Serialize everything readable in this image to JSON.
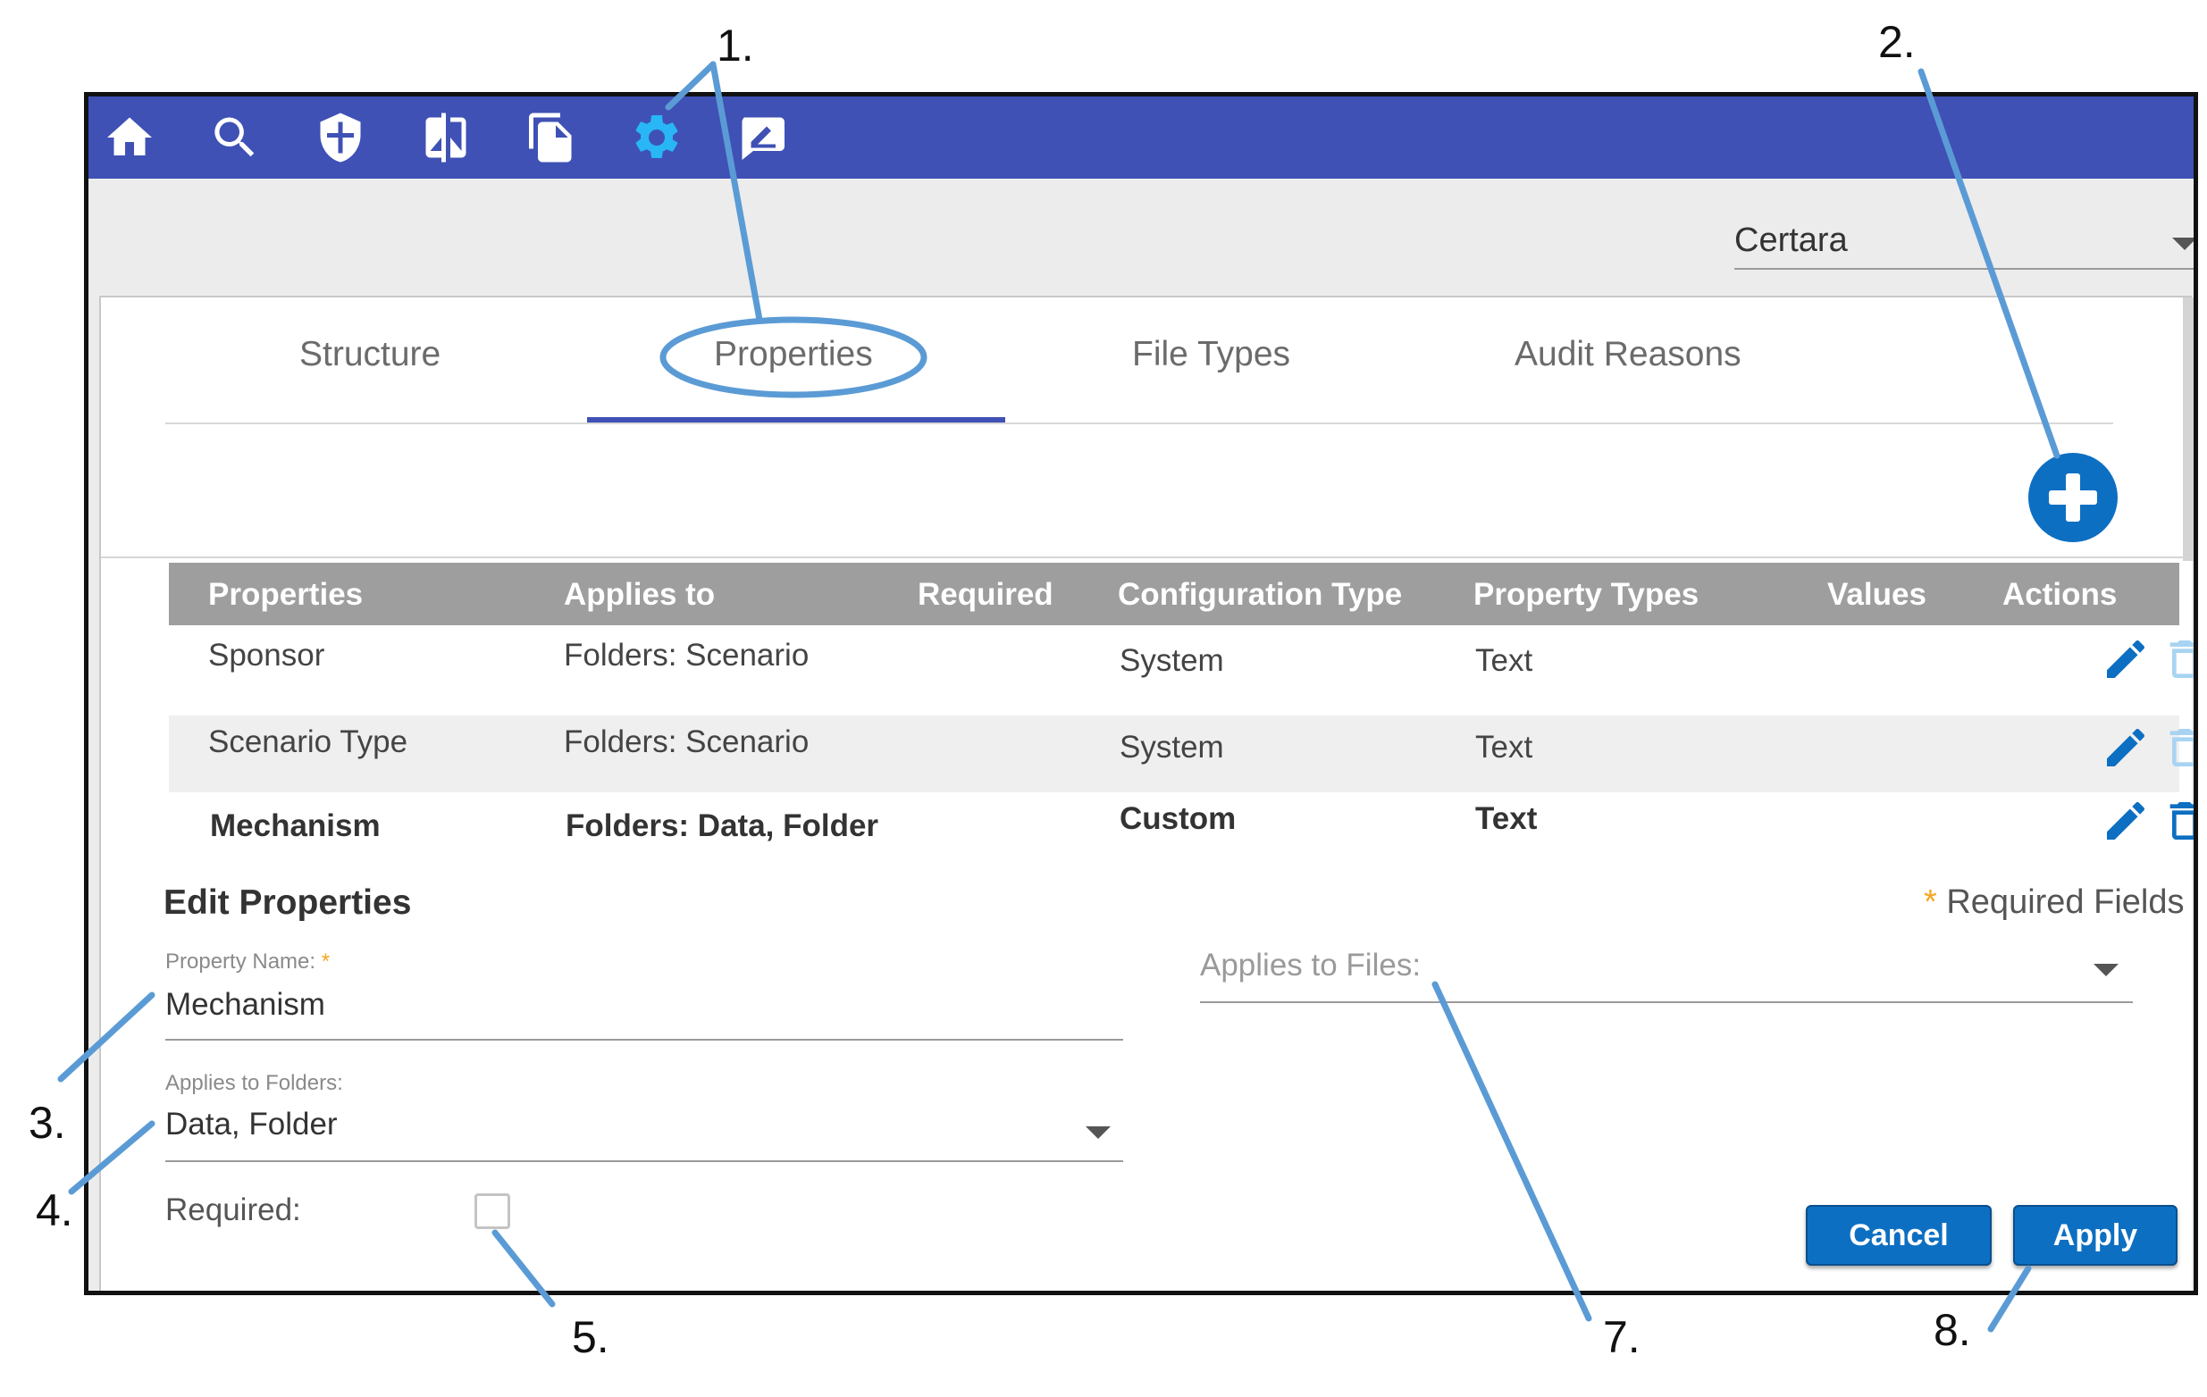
{
  "colors": {
    "topbar": "#3f51b5",
    "accent": "#0d6fc2",
    "active_icon": "#29b6f6",
    "table_header": "#9e9e9e",
    "callout": "#5b9bd5",
    "required_star": "#f5a623"
  },
  "toolbar": {
    "icons": [
      "home-icon",
      "search-icon",
      "shield-icon",
      "compare-icon",
      "documents-icon",
      "gear-icon",
      "signature-icon"
    ],
    "active": "gear-icon"
  },
  "organization": {
    "selected": "Certara"
  },
  "tabs": [
    {
      "label": "Structure"
    },
    {
      "label": "Properties",
      "active": true
    },
    {
      "label": "File Types"
    },
    {
      "label": "Audit Reasons"
    }
  ],
  "table": {
    "headers": [
      "Properties",
      "Applies to",
      "Required",
      "Configuration Type",
      "Property Types",
      "Values",
      "Actions"
    ],
    "rows": [
      {
        "property": "Sponsor",
        "applies_to": "Folders: Scenario",
        "config_type": "System",
        "property_type": "Text"
      },
      {
        "property": "Scenario Type",
        "applies_to": "Folders: Scenario",
        "config_type": "System",
        "property_type": "Text"
      },
      {
        "property": "Mechanism",
        "applies_to": "Folders: Data, Folder",
        "config_type": "Custom",
        "property_type": "Text",
        "selected": true
      }
    ]
  },
  "edit": {
    "heading": "Edit Properties",
    "required_note_star": "*",
    "required_note": "Required Fields",
    "property_name_label": "Property Name:",
    "property_name_star": "*",
    "property_name_value": "Mechanism",
    "applies_folders_label": "Applies to Folders:",
    "applies_folders_value": "Data, Folder",
    "applies_files_placeholder": "Applies to Files:",
    "required_label": "Required:",
    "required_checked": false,
    "cancel_label": "Cancel",
    "apply_label": "Apply"
  },
  "callouts": [
    "1.",
    "2.",
    "3.",
    "4.",
    "5.",
    "7.",
    "8."
  ]
}
